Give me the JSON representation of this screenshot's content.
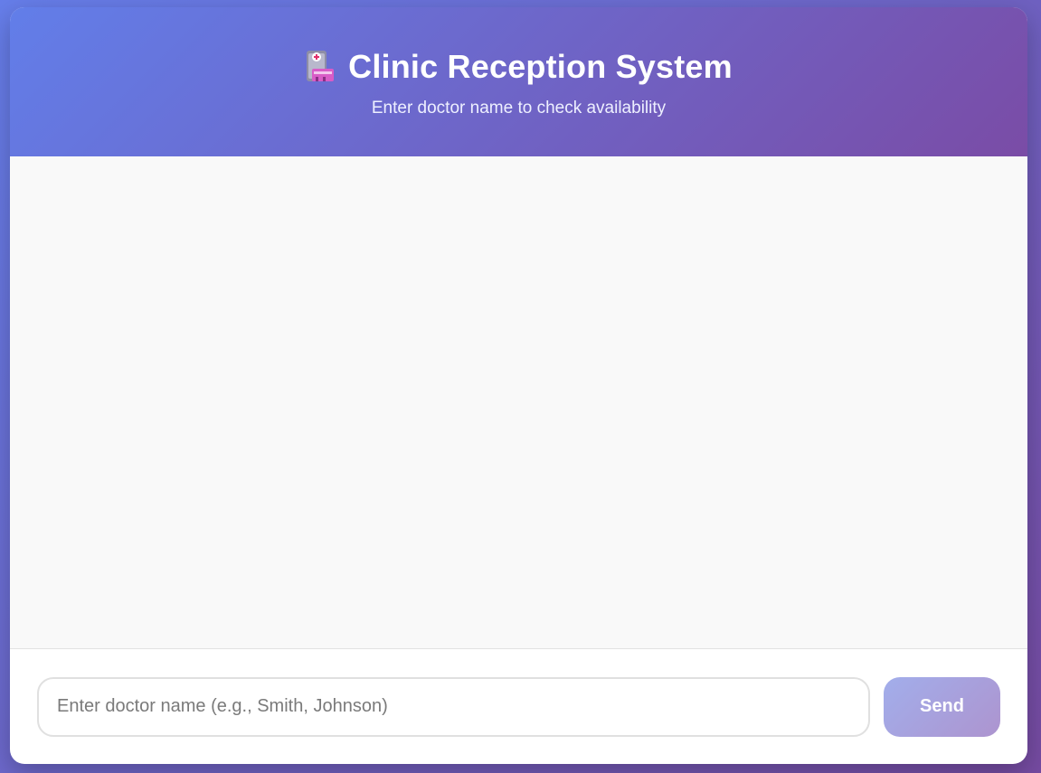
{
  "header": {
    "icon": "hospital-icon",
    "title": "Clinic Reception System",
    "subtitle": "Enter doctor name to check availability"
  },
  "chat": {
    "messages": []
  },
  "input": {
    "placeholder": "Enter doctor name (e.g., Smith, Johnson)",
    "value": ""
  },
  "send": {
    "label": "Send"
  },
  "colors": {
    "background_gradient": [
      "#667eea",
      "#764ba2"
    ],
    "send_button_gradient": [
      "#a2aeeb",
      "#ad94cf"
    ]
  }
}
